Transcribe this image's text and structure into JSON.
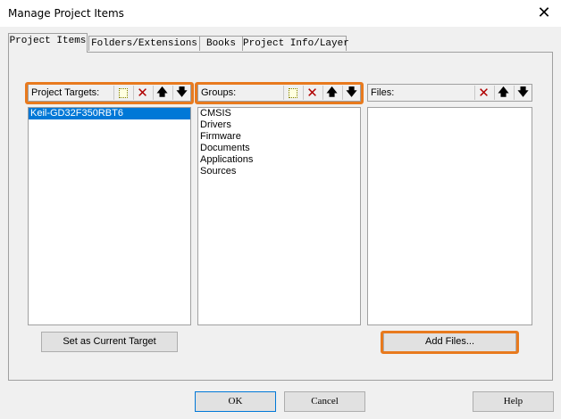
{
  "window": {
    "title": "Manage Project Items",
    "close_glyph": "✕"
  },
  "tabs": [
    {
      "label": "Project Items",
      "active": true
    },
    {
      "label": "Folders/Extensions"
    },
    {
      "label": "Books"
    },
    {
      "label": "Project Info/Layer"
    }
  ],
  "targets": {
    "label": "Project Targets:",
    "items": [
      "Keil-GD32F350RBT6"
    ],
    "selected_index": 0,
    "set_current_label": "Set as Current Target"
  },
  "groups": {
    "label": "Groups:",
    "items": [
      "CMSIS",
      "Drivers",
      "Firmware",
      "Documents",
      "Applications",
      "Sources"
    ]
  },
  "files": {
    "label": "Files:",
    "items": [],
    "add_files_label": "Add Files..."
  },
  "icons": {
    "new": "new-item-icon",
    "delete": "delete-icon",
    "up": "move-up-icon",
    "down": "move-down-icon"
  },
  "glyphs": {
    "delete": "✕",
    "up": "🡅",
    "down": "🡇"
  },
  "footer": {
    "ok_label": "OK",
    "cancel_label": "Cancel",
    "help_label": "Help"
  },
  "colors": {
    "highlight": "#e87a1e",
    "selection": "#0078d7"
  }
}
